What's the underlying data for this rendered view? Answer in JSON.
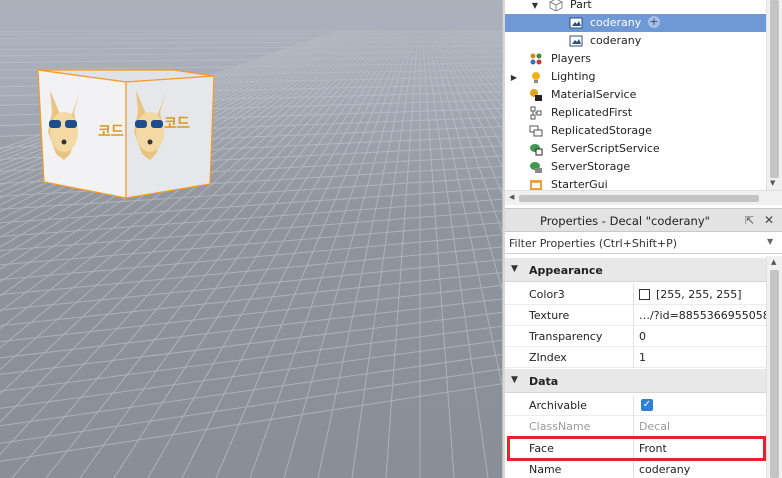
{
  "explorer": {
    "items": [
      {
        "label": "Part",
        "icon": "part-icon",
        "expanded": true
      },
      {
        "label": "coderany",
        "icon": "decal-icon",
        "selected": true
      },
      {
        "label": "coderany",
        "icon": "decal-icon"
      },
      {
        "label": "Players",
        "icon": "players-icon"
      },
      {
        "label": "Lighting",
        "icon": "lighting-icon",
        "collapsed": true
      },
      {
        "label": "MaterialService",
        "icon": "material-service-icon"
      },
      {
        "label": "ReplicatedFirst",
        "icon": "replicated-first-icon"
      },
      {
        "label": "ReplicatedStorage",
        "icon": "replicated-storage-icon"
      },
      {
        "label": "ServerScriptService",
        "icon": "server-script-service-icon"
      },
      {
        "label": "ServerStorage",
        "icon": "server-storage-icon"
      },
      {
        "label": "StarterGui",
        "icon": "starter-gui-icon"
      }
    ]
  },
  "properties": {
    "title": "Properties - Decal \"coderany\"",
    "filter_placeholder": "Filter Properties (Ctrl+Shift+P)",
    "categories": [
      {
        "name": "Appearance",
        "rows": [
          {
            "name": "Color3",
            "value": "[255, 255, 255]",
            "swatch": "#ffffff"
          },
          {
            "name": "Texture",
            "value": "…/?id=88553669550586"
          },
          {
            "name": "Transparency",
            "value": "0"
          },
          {
            "name": "ZIndex",
            "value": "1"
          }
        ]
      },
      {
        "name": "Data",
        "rows": [
          {
            "name": "Archivable",
            "checked": true
          },
          {
            "name": "ClassName",
            "value": "Decal",
            "readonly": true
          },
          {
            "name": "Face",
            "value": "Front",
            "highlighted": true
          },
          {
            "name": "Name",
            "value": "coderany"
          }
        ]
      }
    ]
  },
  "viewport": {
    "decal_text": "코드래니"
  },
  "colors": {
    "selection": "#6f98d6",
    "highlight_box": "#e3242b",
    "checkbox": "#2f7fd6",
    "floor": "#8f949d"
  }
}
